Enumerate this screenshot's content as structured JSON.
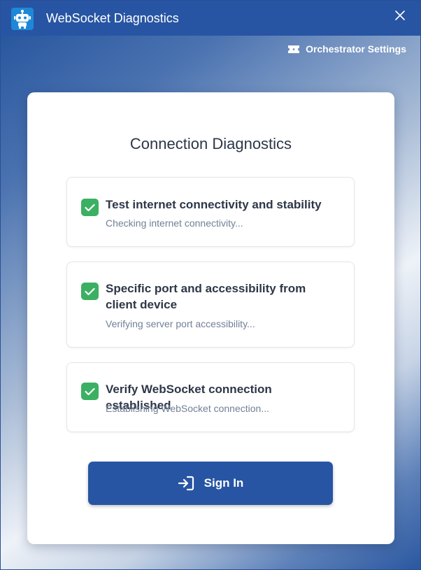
{
  "window": {
    "title": "WebSocket Diagnostics",
    "app_icon": "robot-icon",
    "close_icon": "close-icon"
  },
  "header": {
    "settings_label": "Orchestrator Settings",
    "settings_icon": "ticket-icon"
  },
  "card": {
    "title": "Connection Diagnostics",
    "steps": [
      {
        "title": "Test internet connectivity and stability",
        "subtitle": "Checking internet connectivity...",
        "status": "checked"
      },
      {
        "title": "Specific port and accessibility from client device",
        "subtitle": "Verifying server port accessibility...",
        "status": "checked"
      },
      {
        "title": "Verify WebSocket connection established",
        "subtitle": "Establishing WebSocket connection...",
        "status": "checked"
      }
    ],
    "signin_label": "Sign In",
    "signin_icon": "login-arrow-icon"
  },
  "colors": {
    "primary": "#2755a3",
    "check_green": "#3bb063",
    "title_text": "#2d3748",
    "subtitle_text": "#718096"
  }
}
